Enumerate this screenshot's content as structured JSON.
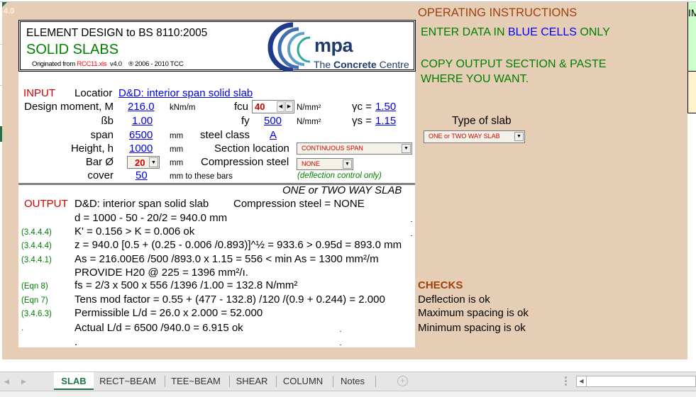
{
  "app": {
    "version_badge": "4.0"
  },
  "header": {
    "title": "ELEMENT DESIGN to BS 8110:2005",
    "subtitle": "SOLID SLABS",
    "originated_prefix": "Originated from",
    "originated_file": "RCC11.xls",
    "originated_version": "v4.0",
    "copyright": "® 2006 - 2010 TCC",
    "logo_mark": "mpa",
    "logo_prefix": "The",
    "logo_bold": "Concrete",
    "logo_suffix": "Centre"
  },
  "input": {
    "section_label": "INPUT",
    "location_label": "Locatior",
    "location_value": "D&D: interior span solid slab",
    "design_moment_label": "Design moment, M",
    "design_moment_value": "216.0",
    "design_moment_unit": "kNm/m",
    "beta_b_label": "ßb",
    "beta_b_value": "1.00",
    "span_label": "span",
    "span_value": "6500",
    "span_unit": "mm",
    "height_label": "Height, h",
    "height_value": "1000",
    "height_unit": "mm",
    "bar_label": "Bar Ø",
    "bar_value": "20",
    "bar_unit": "mm",
    "cover_label": "cover",
    "cover_value": "50",
    "cover_unit": "mm to these bars",
    "fcu_label": "fcu",
    "fcu_value": "40",
    "fcu_unit": "N/mm²",
    "fy_label": "fy",
    "fy_value": "500",
    "fy_unit": "N/mm²",
    "gamma_c_label": "γc =",
    "gamma_c_value": "1.50",
    "gamma_s_label": "γs =",
    "gamma_s_value": "1.15",
    "steel_class_label": "steel class",
    "steel_class_value": "A",
    "section_location_label": "Section location",
    "section_location_value": "CONTINUOUS SPAN",
    "compression_steel_label": "Compression steel",
    "compression_steel_value": "NONE",
    "compression_note": "(deflection control only)"
  },
  "slab_type": {
    "label": "Type of slab",
    "value": "ONE or TWO WAY SLAB"
  },
  "output": {
    "section_label": "OUTPUT",
    "slab_type_heading": "ONE or TWO WAY SLAB",
    "location": "D&D: interior span solid slab",
    "compression": "Compression steel =  NONE",
    "lines": [
      {
        "ref": "",
        "text": "d = 1000 - 50 - 20/2 = 940.0 mm"
      },
      {
        "ref": "(3.4.4.4)",
        "text": "K' = 0.156 > K = 0.006  ok"
      },
      {
        "ref": "(3.4.4.4)",
        "text": "z = 940.0 [0.5 + (0.25 - 0.006 /0.893)]^½ = 933.6 > 0.95d = 893.0 mm"
      },
      {
        "ref": "(3.4.4.1)",
        "text": "As = 216.00E6 /500 /893.0 x 1.15 = 556 < min As = 1300 mm²/m"
      },
      {
        "ref": "",
        "text": "PROVIDE H20 @ 225 = 1396 mm²/ı."
      },
      {
        "ref": "(Eqn 8)",
        "text": "fs =  2/3 x 500 x 556 /1396 /1.00 = 132.8 N/mm²"
      },
      {
        "ref": "(Eqn 7)",
        "text": "Tens mod factor = 0.55 + (477 - 132.8) /120 /(0.9 + 0.244) = 2.000"
      },
      {
        "ref": "(3.4.6.3)",
        "text": "Permissible L/d = 26.0 x 2.000 = 52.000"
      },
      {
        "ref": ".",
        "text": "Actual L/d = 6500 /940.0 = 6.915  ok"
      },
      {
        "ref": "",
        "text": "."
      }
    ]
  },
  "instructions": {
    "title": "OPERATING INSTRUCTIONS",
    "line1_a": "ENTER DATA IN",
    "line1_b": "BLUE CELLS",
    "line1_c": "ONLY",
    "line2": "COPY OUTPUT SECTION & PASTE",
    "line3": "WHERE YOU WANT."
  },
  "checks": {
    "title": "CHECKS",
    "items": [
      "Deflection is ok",
      "Maximum spacing is ok",
      "Minimum spacing is ok"
    ]
  },
  "right_edge_text": "IM",
  "tabs": [
    {
      "label": "SLAB",
      "active": true
    },
    {
      "label": "RECT~BEAM",
      "active": false
    },
    {
      "label": "TEE~BEAM",
      "active": false
    },
    {
      "label": "SHEAR",
      "active": false
    },
    {
      "label": "COLUMN",
      "active": false
    },
    {
      "label": "Notes",
      "active": false
    }
  ],
  "icons": {
    "add_sheet": "+",
    "prev_sheet": "◀",
    "next_sheet": "▶",
    "dropdown": "▼",
    "spin_left": "◀",
    "spin_right": "▶",
    "scroll_left": "◀"
  },
  "colors": {
    "background": "#e6cdb5",
    "input_link": "#0000ee",
    "heading_red": "#cc0000",
    "instructions_green": "#008000",
    "checks_brown": "#a0400a",
    "tab_active": "#217346"
  }
}
